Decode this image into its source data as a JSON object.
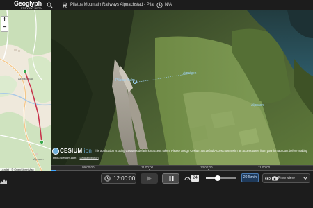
{
  "app": {
    "name": "Geoglyph",
    "name_sub": "PREVIEW BETA"
  },
  "header": {
    "route_title": "Pilatus Mountain Railways Alpnachstad - Pilatus Kulm,",
    "time_value": "N/A"
  },
  "map2d": {
    "zoom_in": "+",
    "zoom_out": "−",
    "labels": [
      "Alpnachstad",
      "Alpnach"
    ],
    "attribution": "Leaflet | © OpenStreetMap"
  },
  "globe": {
    "pois": [
      "Pilatus Kulm",
      "Ämsigen",
      "Alpnach"
    ],
    "cesium_logo": "CESIUM",
    "cesium_ion": "ion",
    "cesium_message": "This application is using Cesium's default ion access token. Please assign Cesium.Ion.defaultAccessToken with an access token from your ion account before making",
    "cesium_link": "https://cesium.com",
    "data_attribution": "Data attribution"
  },
  "timeline": {
    "ticks": [
      "09:00:00",
      "11:00:00",
      "13:00:00",
      "11:00:00"
    ],
    "progress": 0.02
  },
  "controls": {
    "time": "12:00:00",
    "speed_value": "24",
    "speed_readout": "204km/h",
    "speed_slider_level": 0.38,
    "view_mode": "Free view"
  },
  "icons": {
    "search": "search-icon",
    "rail": "railway-icon",
    "clock": "clock-icon",
    "chart": "elevation-chart-icon",
    "play": "play-icon",
    "pause": "pause-icon",
    "speed": "speedometer-icon",
    "eye": "eye-icon",
    "camera": "camera-icon",
    "chevron": "chevron-down-icon"
  },
  "colors": {
    "accent": "#3da5ff",
    "poi": "#9fd3f5",
    "route": "#c8354d",
    "lake": "#2f5f6e"
  }
}
